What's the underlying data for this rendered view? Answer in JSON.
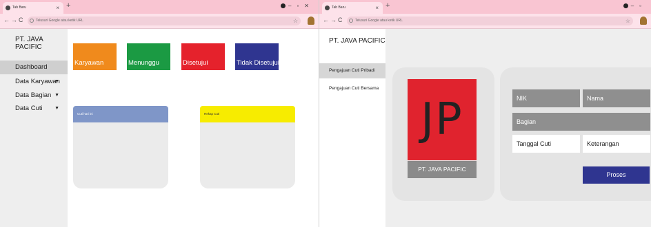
{
  "left": {
    "browser": {
      "tab_title": "Tab Baru",
      "omnibox_placeholder": "Telusuri Google atau ketik URL"
    },
    "sidebar": {
      "brand": "PT. JAVA PACIFIC",
      "items": [
        {
          "label": "Dashboard",
          "active": true
        },
        {
          "label": "Data Karyawan",
          "caret": "▼"
        },
        {
          "label": "Data Bagian",
          "caret": "▼"
        },
        {
          "label": "Data Cuti",
          "caret": "▼"
        }
      ]
    },
    "stats": [
      {
        "label": "Karyawan",
        "color": "#f08a1c"
      },
      {
        "label": "Menunggu",
        "color": "#1b9a43"
      },
      {
        "label": "Disetujui",
        "color": "#e5222c"
      },
      {
        "label": "Tidak Disetujui",
        "color": "#2f3590"
      }
    ],
    "panels": [
      {
        "title": "Cuti hari ini",
        "color": "#7f96c8"
      },
      {
        "title": "Rekap Cuti",
        "color": "#f7ec00"
      }
    ]
  },
  "right": {
    "browser": {
      "tab_title": "Tab Baru",
      "omnibox_placeholder": "Telusuri Google atau ketik URL"
    },
    "sidebar": {
      "brand": "PT. JAVA PACIFIC",
      "items": [
        {
          "label": "Pengajuan Cuti Pribadi",
          "active": true
        },
        {
          "label": "Pengajuan Cuti Bersama"
        }
      ]
    },
    "logo": {
      "text": "JP",
      "caption": "PT. JAVA PACIFIC"
    },
    "form": {
      "nik": "NIK",
      "nama": "Nama",
      "bagian": "Bagian",
      "tanggal_cuti": "Tanggal Cuti",
      "keterangan": "Keterangan",
      "submit": "Proses"
    }
  }
}
